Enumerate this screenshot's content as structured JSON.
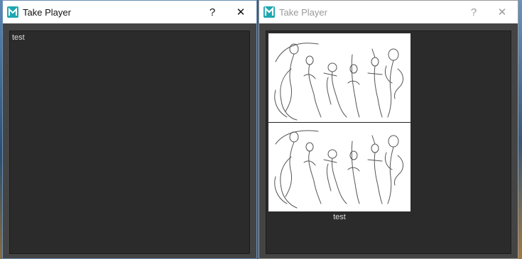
{
  "windows": [
    {
      "title": "Take Player",
      "help_label": "?",
      "close_label": "✕",
      "content_text": "test"
    },
    {
      "title": "Take Player",
      "help_label": "?",
      "close_label": "✕",
      "caption": "test"
    }
  ],
  "icons": {
    "left_app": "maya-icon",
    "right_app": "maya-m-icon"
  },
  "colors": {
    "panel_bg": "#2b2b2b",
    "window_bg": "#444444",
    "accent_teal": "#1fa7b0"
  }
}
